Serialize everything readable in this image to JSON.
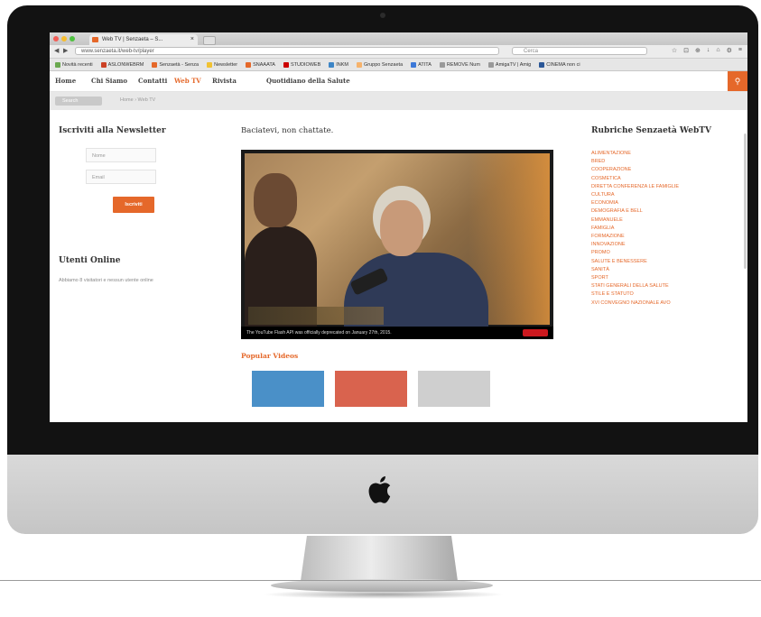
{
  "browser": {
    "tab_title": "Web TV | Senzaeta – S...",
    "tab_close": "×",
    "url": "www.senzaeta.it/web-tv/player",
    "search_placeholder": "Cerca",
    "tools": [
      "☆",
      "⊡",
      "⊕",
      "↓",
      "⌂",
      "⚙",
      "≡"
    ],
    "bookmarks": [
      {
        "label": "Novità recenti",
        "color": "#6aa84f"
      },
      {
        "label": "ASLONWEBRM",
        "color": "#cc4125"
      },
      {
        "label": "Senzaetà - Senza",
        "color": "#e5682a"
      },
      {
        "label": "Newsletter",
        "color": "#f1c232"
      },
      {
        "label": "SNAAATA",
        "color": "#e5682a"
      },
      {
        "label": "STUDIOWEB",
        "color": "#cc0000"
      },
      {
        "label": "INKM",
        "color": "#3d85c6"
      },
      {
        "label": "Gruppo Senzaeta",
        "color": "#f6b26b"
      },
      {
        "label": "ATITA",
        "color": "#3c78d8"
      },
      {
        "label": "REMOVE Num",
        "color": "#999999"
      },
      {
        "label": "AmigaTV | Amig",
        "color": "#999999"
      },
      {
        "label": "CINEMA non ci",
        "color": "#2b5797"
      }
    ]
  },
  "sitenav": {
    "items": [
      "Home",
      "Chi Siamo",
      "Contatti",
      "Web TV",
      "Rivista",
      "Quotidiano della Salute"
    ],
    "active_index": 3,
    "search_icon": "search-icon"
  },
  "breadcrumb": {
    "button": "Search",
    "path": "Home › Web TV"
  },
  "newsletter": {
    "title": "Iscriviti alla Newsletter",
    "name_placeholder": "Nome",
    "email_placeholder": "Email",
    "submit": "Iscriviti"
  },
  "online": {
    "title": "Utenti Online",
    "text": "Abbiamo 8 visitatori e nessun utente online"
  },
  "video": {
    "title": "Baciatevi, non chattate.",
    "bar_text": "The YouTube Flash API was officially deprecated on January 27th, 2015."
  },
  "popular": {
    "title": "Popular Videos",
    "thumb_colors": [
      "#4a90c8",
      "#d9634e",
      "#cfcfcf"
    ]
  },
  "categories": {
    "title": "Rubriche Senzaetà WebTV",
    "items": [
      "ALIMENTAZIONE",
      "BRED",
      "COOPERAZIONE",
      "COSMETICA",
      "DIRETTA CONFERENZA LE FAMIGLIE",
      "CULTURA",
      "ECONOMIA",
      "DEMOGRAFIA E BELL",
      "EMMANUELE",
      "FAMIGLIA",
      "FORMAZIONE",
      "INNOVAZIONE",
      "PROMO",
      "SALUTE E BENESSERE",
      "SANITÀ",
      "SPORT",
      "STATI GENERALI DELLA SALUTE",
      "STILE E STATUTO",
      "XVI CONVEGNO NAZIONALE AVO"
    ]
  },
  "colors": {
    "accent": "#e5682a",
    "bezel": "#121212",
    "chin": "#cfcfcf"
  }
}
